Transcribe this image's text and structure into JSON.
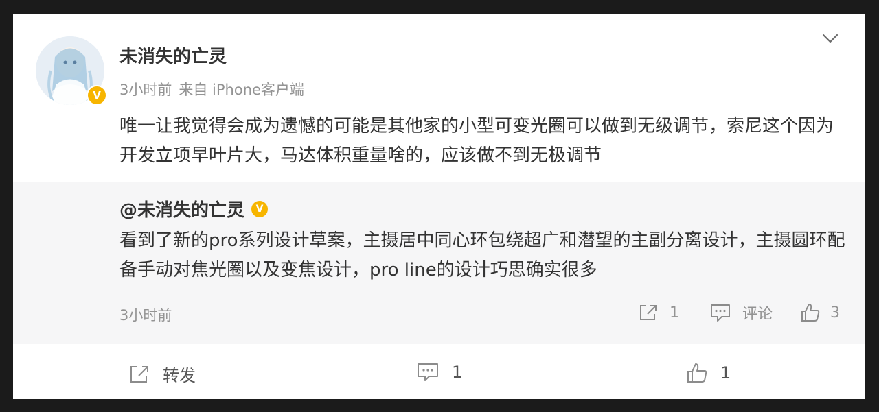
{
  "post": {
    "author": "未消失的亡灵",
    "time": "3小时前",
    "source": "来自 iPhone客户端",
    "text": "唯一让我觉得会成为遗憾的可能是其他家的小型可变光圈可以做到无级调节，索尼这个因为开发立项早叶片大，马达体积重量啥的，应该做不到无极调节",
    "verified_badge": "V"
  },
  "quote": {
    "author": "@未消失的亡灵",
    "verified_badge": "V",
    "text": "看到了新的pro系列设计草案，主摄居中同心环包绕超广和潜望的主副分离设计，主摄圆环配备手动对焦光圈以及变焦设计，pro line的设计巧思确实很多",
    "time": "3小时前",
    "repost_count": "1",
    "comment_label": "评论",
    "like_count": "3"
  },
  "actions": {
    "repost_label": "转发",
    "comment_count": "1",
    "like_count": "1"
  },
  "icons": {
    "more": "chevron-down-icon",
    "repost": "share-icon",
    "comment": "comment-icon",
    "like": "thumbs-up-icon"
  },
  "colors": {
    "background": "#ffffff",
    "quote_background": "#f6f6f7",
    "meta_text": "#939393",
    "main_text": "#333333",
    "verified": "#f7b500"
  }
}
